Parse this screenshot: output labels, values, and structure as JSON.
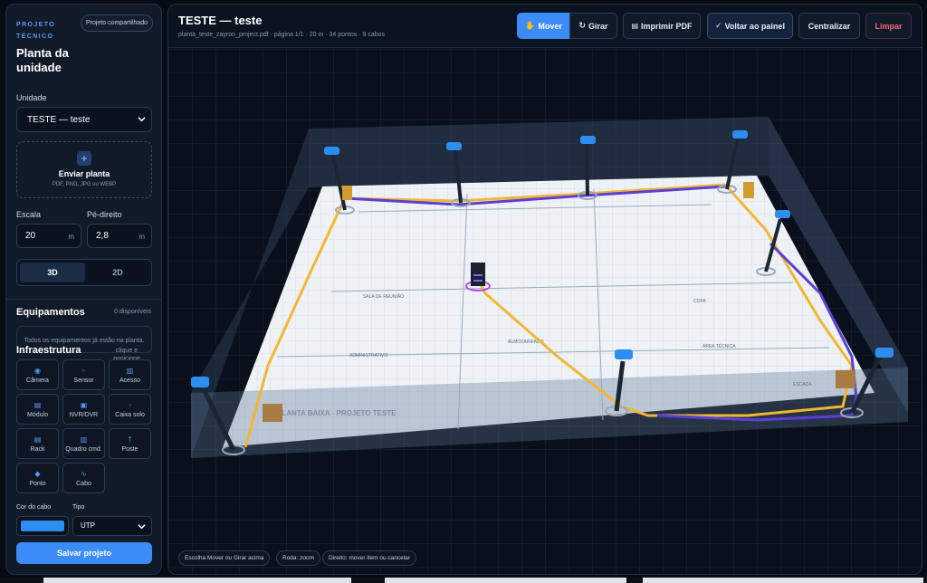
{
  "sidebar": {
    "eyebrow": "PROJETO TÉCNICO",
    "shared_badge": "Projeto compartilhado",
    "title": "Planta da unidade",
    "unit_label": "Unidade",
    "unit_value": "TESTE — teste",
    "upload_icon": "+",
    "upload_title": "Enviar planta",
    "upload_sub": "PDF, PNG, JPG ou WEBP",
    "scale_label": "Escala",
    "scale_value": "20",
    "scale_unit": "m",
    "height_label": "Pé-direito",
    "height_value": "2,8",
    "height_unit": "m",
    "view_3d": "3D",
    "view_2d": "2D",
    "equip_title": "Equipamentos",
    "equip_count": "0 disponíveis",
    "empty_note": "Todos os equipamentos já estão na planta.",
    "empty_hint": "clique e posicione",
    "infra_title": "Infraestrutura",
    "equipment": [
      {
        "label": "Câmera",
        "icon": "◉"
      },
      {
        "label": "Sensor",
        "icon": "~"
      },
      {
        "label": "Acesso",
        "icon": "▥"
      },
      {
        "label": "Módulo",
        "icon": "▤"
      },
      {
        "label": "NVR/DVR",
        "icon": "▣"
      },
      {
        "label": "Caixa solo",
        "icon": "▫"
      },
      {
        "label": "Rack",
        "icon": "▤"
      },
      {
        "label": "Quadro cmd.",
        "icon": "▥"
      },
      {
        "label": "Poste",
        "icon": "†"
      },
      {
        "label": "Ponto",
        "icon": "◆"
      },
      {
        "label": "Cabo",
        "icon": "∿"
      }
    ],
    "cable_color_label": "Cor do cabo",
    "cable_color": "#2e8df0",
    "type_label": "Tipo",
    "type_value": "UTP",
    "save_label": "Salvar projeto"
  },
  "header": {
    "title": "TESTE — teste",
    "subtitle": "planta_teste_zayron_project.pdf · página 1/1 · 20 m · 34 pontos · 9 cabos",
    "move_label": "Mover",
    "rotate_label": "Girar",
    "print_label": "Imprimir PDF",
    "back_label": "Voltar ao painel",
    "center_label": "Centralizar",
    "clear_label": "Limpar"
  },
  "plan": {
    "plan_title": "PLANTA BAIXA - PROJETO TESTE",
    "rooms": [
      "SALA DE REUNIÃO",
      "ADMINISTRATIVO",
      "ALMOXARIFADO",
      "COPA",
      "ÁREA TÉCNICA",
      "ESCADA"
    ]
  },
  "hints": {
    "h1": "Escolha Mover ou Girar acima",
    "h2": "Roda: zoom",
    "h3": "Direito: mover item ou cancelar"
  },
  "colors": {
    "accent": "#3b8cf6",
    "danger": "#f36a7a",
    "cable_yellow": "#f2b632",
    "cable_purple": "#5b3fd6",
    "camera_blue": "#2e8df0"
  }
}
